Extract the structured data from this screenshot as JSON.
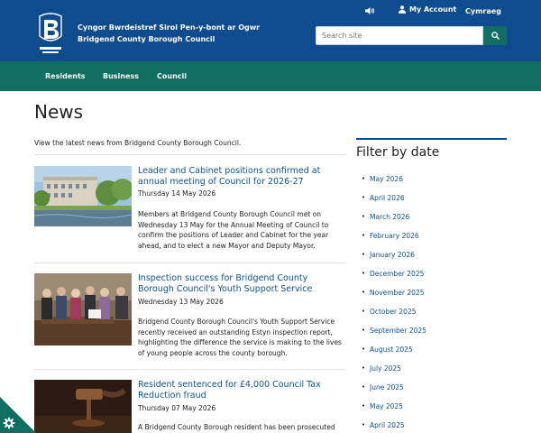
{
  "header": {
    "name_welsh": "Cyngor Bwrdeistref Sirol Pen-y-bont ar Ogwr",
    "name_english": "Bridgend County Borough Council",
    "account_label": "My Account",
    "language_label": "Cymraeg",
    "search_placeholder": "Search site",
    "icons": {
      "speaker": "speaker-icon",
      "account": "user-icon",
      "search": "search-icon"
    }
  },
  "nav": {
    "items": [
      "Residents",
      "Business",
      "Council"
    ]
  },
  "main": {
    "title": "News",
    "intro": "View the latest news from Bridgend County Borough Council."
  },
  "articles": [
    {
      "title": "Leader and Cabinet positions confirmed at annual meeting of Council for 2026-27",
      "date": "Thursday 14 May 2026",
      "body": "Members at Bridgend County Borough Council met on Wednesday 13 May for the Annual Meeting of Council to confirm the positions of Leader and Cabinet for the year ahead, and to elect a new Mayor and Deputy Mayor."
    },
    {
      "title": "Inspection success for Bridgend County Borough Council's Youth Support Service",
      "date": "Wednesday 13 May 2026",
      "body": "Bridgend County Borough Council's Youth Support Service recently received an outstanding Estyn inspection report, highlighting the difference the service is making to the lives of young people across the county borough."
    },
    {
      "title": "Resident sentenced for £4,000 Council Tax Reduction fraud",
      "date": "Thursday 07 May 2026",
      "body": "A Bridgend County Borough resident has been prosecuted"
    }
  ],
  "sidebar": {
    "title": "Filter by date",
    "dates": [
      "May 2026",
      "April 2026",
      "March 2026",
      "February 2026",
      "January 2026",
      "December 2025",
      "November 2025",
      "October 2025",
      "September 2025",
      "August 2025",
      "July 2025",
      "June 2025",
      "May 2025",
      "April 2025"
    ]
  },
  "colors": {
    "header": "#0f4b8f",
    "nav": "#0f6e5f",
    "link": "#0b5394",
    "cookie": "#0f6e5f"
  }
}
